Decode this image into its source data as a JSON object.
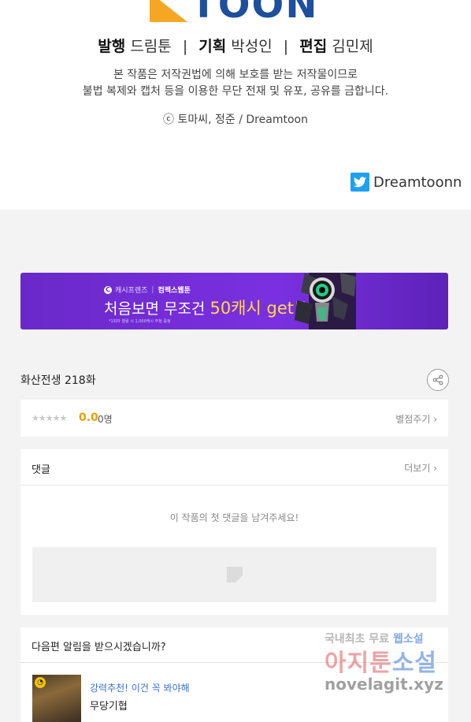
{
  "header": {
    "logo_text": "TOON",
    "credits": {
      "publish_label": "발행",
      "publish_value": "드림툰",
      "plan_label": "기획",
      "plan_value": "박성인",
      "edit_label": "편집",
      "edit_value": "김민제",
      "separator": "|"
    },
    "notice_line1": "본 작품은 저작권법에 의해 보호를 받는 저작물이므로",
    "notice_line2": "불법 복제와 캡처 등을 이용한 무단 전재 및 유포, 공유를 금합니다.",
    "copyright": "ⓒ 토마씨, 정준 / Dreamtoon",
    "twitter_handle": "Dreamtoonn"
  },
  "banner": {
    "brand1": "캐시프렌즈",
    "brand2": "컴렉스웹툰",
    "headline_prefix": "처음보면 무조건 ",
    "headline_highlight": "50캐시 get!!",
    "fineprint": "*1회차 열람 시 1,000캐시 추첨 증정"
  },
  "episode": {
    "title": "화산전생 218화"
  },
  "rating": {
    "stars": "★★★★★",
    "score": "0.0",
    "count": "0명",
    "rate_link": "별점주기 ›"
  },
  "comments": {
    "title": "댓글",
    "more": "더보기 ›",
    "empty_message": "이 작품의 첫 댓글을 남겨주세요!"
  },
  "next_episode": {
    "question": "다음편 알림을 받으시겠습니까?",
    "rec_label": "강력추천! 이건 꼭 봐야해",
    "rec_title": "무당기협"
  },
  "watermark": {
    "line1a": "국내최초 무료 ",
    "line1b": "웹소설",
    "line2a": "아지툰",
    "line2b": "소설",
    "line3": "novelagit.xyz"
  },
  "colors": {
    "banner_purple": "#7a30e0",
    "brand_blue": "#1d4f9c",
    "logo_orange": "#f5a623",
    "score_orange": "#e8a000",
    "link_blue": "#3a6fd8"
  }
}
